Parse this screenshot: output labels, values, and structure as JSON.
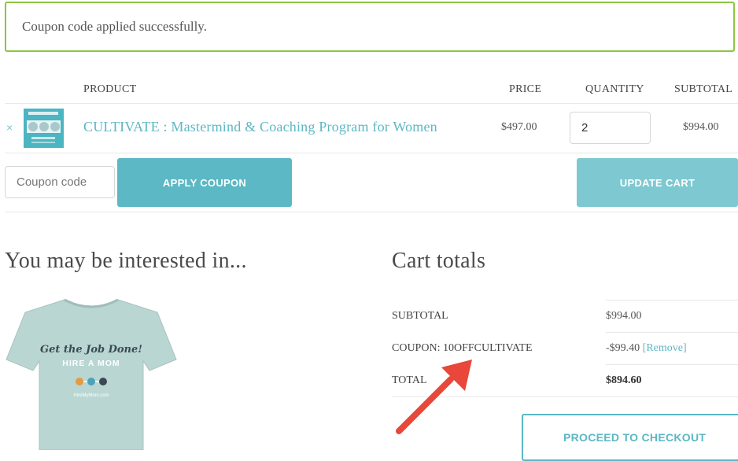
{
  "notice": {
    "message": "Coupon code applied successfully."
  },
  "cart_table": {
    "headers": {
      "product": "PRODUCT",
      "price": "PRICE",
      "quantity": "QUANTITY",
      "subtotal": "SUBTOTAL"
    },
    "items": [
      {
        "remove_symbol": "×",
        "thumbnail_icon": "product-thumbnail",
        "name": "CULTIVATE : Mastermind & Coaching Program for Women",
        "price": "$497.00",
        "quantity": "2",
        "subtotal": "$994.00"
      }
    ]
  },
  "actions": {
    "coupon_placeholder": "Coupon code",
    "apply_coupon": "APPLY COUPON",
    "update_cart": "UPDATE CART"
  },
  "cross_sells": {
    "title": "You may be interested in...",
    "product_image": {
      "line1": "Get the Job Done!",
      "line2": "HIRE A MOM",
      "line3": "HireMyMom.com"
    }
  },
  "cart_totals": {
    "title": "Cart totals",
    "subtotal_label": "SUBTOTAL",
    "subtotal_value": "$994.00",
    "coupon_label": "COUPON: 10OFFCULTIVATE",
    "coupon_value": "-$99.40",
    "coupon_remove": "[Remove]",
    "total_label": "TOTAL",
    "total_value": "$894.60",
    "checkout": "PROCEED TO CHECKOUT"
  },
  "colors": {
    "accent": "#5bb8c4",
    "notice_border": "#8cc63f",
    "annotation_arrow": "#e8473a"
  }
}
